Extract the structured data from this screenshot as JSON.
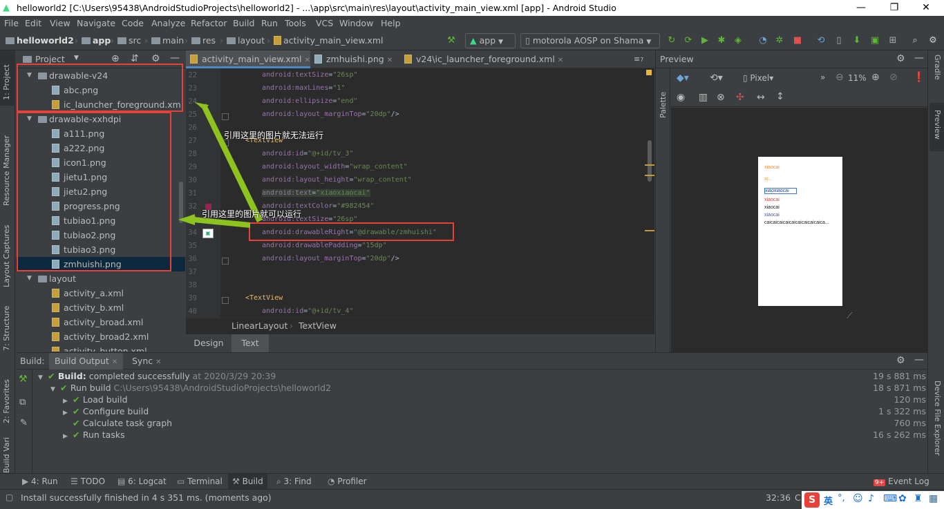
{
  "window": {
    "title": "helloworld2 [C:\\Users\\95438\\AndroidStudioProjects\\helloworld2] - ...\\app\\src\\main\\res\\layout\\activity_main_view.xml [app] - Android Studio",
    "minimize": "—",
    "maximize": "❐",
    "close": "✕"
  },
  "menu": [
    "File",
    "Edit",
    "View",
    "Navigate",
    "Code",
    "Analyze",
    "Refactor",
    "Build",
    "Run",
    "Tools",
    "VCS",
    "Window",
    "Help"
  ],
  "breadcrumbs": [
    "helloworld2",
    "app",
    "src",
    "main",
    "res",
    "layout",
    "activity_main_view.xml"
  ],
  "toolbar": {
    "run_config": "app",
    "device": "motorola AOSP on Shama"
  },
  "left_tabs": {
    "project": "1: Project",
    "resource_manager": "Resource Manager",
    "layout_captures": "Layout Captures",
    "structure": "7: Structure",
    "favorites": "2: Favorites",
    "build_variants": "Build Variants"
  },
  "project_panel": {
    "title": "Project",
    "tree": [
      {
        "type": "folder",
        "label": "drawable-v24",
        "indent": 0
      },
      {
        "type": "img",
        "label": "abc.png",
        "indent": 1
      },
      {
        "type": "xml",
        "label": "ic_launcher_foreground.xml",
        "indent": 1
      },
      {
        "type": "folder",
        "label": "drawable-xxhdpi",
        "indent": 0
      },
      {
        "type": "img",
        "label": "a111.png",
        "indent": 1
      },
      {
        "type": "img",
        "label": "a222.png",
        "indent": 1
      },
      {
        "type": "img",
        "label": "icon1.png",
        "indent": 1
      },
      {
        "type": "img",
        "label": "jietu1.png",
        "indent": 1
      },
      {
        "type": "img",
        "label": "jietu2.png",
        "indent": 1
      },
      {
        "type": "img",
        "label": "progress.png",
        "indent": 1
      },
      {
        "type": "img",
        "label": "tubiao1.png",
        "indent": 1
      },
      {
        "type": "img",
        "label": "tubiao2.png",
        "indent": 1
      },
      {
        "type": "img",
        "label": "tubiao3.png",
        "indent": 1
      },
      {
        "type": "img",
        "label": "zmhuishi.png",
        "indent": 1,
        "selected": true
      },
      {
        "type": "folder",
        "label": "layout",
        "indent": 0
      },
      {
        "type": "xml",
        "label": "activity_a.xml",
        "indent": 1
      },
      {
        "type": "xml",
        "label": "activity_b.xml",
        "indent": 1
      },
      {
        "type": "xml",
        "label": "activity_broad.xml",
        "indent": 1
      },
      {
        "type": "xml",
        "label": "activity_broad2.xml",
        "indent": 1
      },
      {
        "type": "xml",
        "label": "activity_button.xml",
        "indent": 1
      }
    ]
  },
  "editor_tabs": [
    "activity_main_view.xml",
    "zmhuishi.png",
    "v24\\ic_launcher_foreground.xml"
  ],
  "editor_tab_overflow": "≡",
  "editor_tab_overflow_count": "7",
  "code_lines": [
    {
      "n": "22",
      "parts": [
        [
          "a",
          "android:"
        ],
        [
          "a",
          "textSize"
        ],
        [
          "p",
          "="
        ],
        [
          "v",
          "\"26sp\""
        ]
      ]
    },
    {
      "n": "23",
      "parts": [
        [
          "a",
          "android:"
        ],
        [
          "a",
          "maxLines"
        ],
        [
          "p",
          "="
        ],
        [
          "v",
          "\"1\""
        ]
      ]
    },
    {
      "n": "24",
      "parts": [
        [
          "a",
          "android:"
        ],
        [
          "a",
          "ellipsize"
        ],
        [
          "p",
          "="
        ],
        [
          "v",
          "\"end\""
        ]
      ]
    },
    {
      "n": "25",
      "parts": [
        [
          "a",
          "android:"
        ],
        [
          "a",
          "layout_marginTop"
        ],
        [
          "p",
          "="
        ],
        [
          "v",
          "\"20dp\""
        ],
        [
          "p",
          "/>"
        ]
      ]
    },
    {
      "n": "26",
      "parts": []
    },
    {
      "n": "27",
      "parts": [
        [
          "t",
          "<TextView"
        ]
      ],
      "outdent": true
    },
    {
      "n": "28",
      "parts": [
        [
          "a",
          "android:"
        ],
        [
          "a",
          "id"
        ],
        [
          "p",
          "="
        ],
        [
          "v",
          "\"@+id/tv_3\""
        ]
      ]
    },
    {
      "n": "29",
      "parts": [
        [
          "a",
          "android:"
        ],
        [
          "a",
          "layout_width"
        ],
        [
          "p",
          "="
        ],
        [
          "v",
          "\"wrap_content\""
        ]
      ]
    },
    {
      "n": "30",
      "parts": [
        [
          "a",
          "android:"
        ],
        [
          "a",
          "layout_height"
        ],
        [
          "p",
          "="
        ],
        [
          "v",
          "\"wrap_content\""
        ]
      ]
    },
    {
      "n": "31",
      "parts": [
        [
          "a",
          "android:"
        ],
        [
          "a",
          "text"
        ],
        [
          "p",
          "="
        ],
        [
          "v",
          "\"xiaoxiaocai\""
        ]
      ]
    },
    {
      "n": "32",
      "parts": [
        [
          "a",
          "android:"
        ],
        [
          "a",
          "textColor"
        ],
        [
          "p",
          "="
        ],
        [
          "v",
          "\"#982454\""
        ]
      ]
    },
    {
      "n": "33",
      "parts": [
        [
          "a",
          "android:"
        ],
        [
          "a",
          "textSize"
        ],
        [
          "p",
          "="
        ],
        [
          "v",
          "\"26sp\""
        ]
      ]
    },
    {
      "n": "34",
      "parts": [
        [
          "a",
          "android:"
        ],
        [
          "a",
          "drawableRight"
        ],
        [
          "p",
          "="
        ],
        [
          "v",
          "\"@drawable/zmhuishi\""
        ]
      ]
    },
    {
      "n": "35",
      "parts": [
        [
          "a",
          "android:"
        ],
        [
          "a",
          "drawablePadding"
        ],
        [
          "p",
          "="
        ],
        [
          "v",
          "\"15dp\""
        ]
      ]
    },
    {
      "n": "36",
      "parts": [
        [
          "a",
          "android:"
        ],
        [
          "a",
          "layout_marginTop"
        ],
        [
          "p",
          "="
        ],
        [
          "v",
          "\"20dp\""
        ],
        [
          "p",
          "/>"
        ]
      ]
    },
    {
      "n": "37",
      "parts": []
    },
    {
      "n": "38",
      "parts": []
    },
    {
      "n": "39",
      "parts": [
        [
          "t",
          "<TextView"
        ]
      ],
      "outdent": true
    },
    {
      "n": "40",
      "parts": [
        [
          "a",
          "android:"
        ],
        [
          "a",
          "id"
        ],
        [
          "p",
          "="
        ],
        [
          "v",
          "\"@+id/tv_4\""
        ]
      ]
    }
  ],
  "editor_breadcrumb": [
    "LinearLayout",
    "TextView"
  ],
  "design_tabs": [
    "Design",
    "Text"
  ],
  "annotations": {
    "top": "引用这里的图片就无法运行",
    "bottom": "引用这里的图片就可以运行"
  },
  "preview": {
    "title": "Preview",
    "device": "Pixel",
    "zoom": "11%",
    "palette_label": "Palette",
    "texts": [
      {
        "t": "xiaocai",
        "c": "#ff8c2a"
      },
      {
        "t": "xi...",
        "c": "#ff8c2a"
      },
      {
        "t": "xiaoxiaocai",
        "c": "#1a3d8f"
      },
      {
        "t": "xiaocai",
        "c": "#e23b3b"
      },
      {
        "t": "xiaocai",
        "c": "#222222"
      },
      {
        "t": "xiaocai",
        "c": "#4455aa"
      },
      {
        "t": "caicaicaicaicaicaicaicaicaica...",
        "c": "#222222"
      }
    ]
  },
  "right_tabs": {
    "gradle": "Gradle",
    "preview": "Preview",
    "device_file_explorer": "Device File Explorer"
  },
  "build_panel": {
    "label": "Build:",
    "tabs": [
      "Build Output",
      "Sync"
    ],
    "rows": [
      {
        "indent": 0,
        "bold": "Build:",
        "text": " completed successfully",
        "extra": " at 2020/3/29 20:39",
        "time": "19 s 881 ms",
        "arrow": "▼"
      },
      {
        "indent": 1,
        "text": "Run build",
        "extra": " C:\\Users\\95438\\AndroidStudioProjects\\helloworld2",
        "time": "18 s 871 ms",
        "arrow": "▼"
      },
      {
        "indent": 2,
        "text": "Load build",
        "extra": "",
        "time": "120 ms",
        "arrow": "▶"
      },
      {
        "indent": 2,
        "text": "Configure build",
        "extra": "",
        "time": "1 s 322 ms",
        "arrow": "▶"
      },
      {
        "indent": 2,
        "text": "Calculate task graph",
        "extra": "",
        "time": "760 ms",
        "arrow": ""
      },
      {
        "indent": 2,
        "text": "Run tasks",
        "extra": "",
        "time": "16 s 262 ms",
        "arrow": "▶"
      }
    ]
  },
  "bottom_tabs": [
    "4: Run",
    "TODO",
    "6: Logcat",
    "Terminal",
    "Build",
    "3: Find",
    "Profiler"
  ],
  "event_log": {
    "label": "Event Log",
    "badge": "9+"
  },
  "status": {
    "message": "Install successfully finished in 4 s 351 ms. (moments ago)",
    "position": "32:36",
    "ime": "英",
    "encoding": "CI"
  },
  "colors": {
    "accent_red": "#e8413a",
    "arrow_green": "#8dc21f",
    "success_green": "#5fb832"
  }
}
